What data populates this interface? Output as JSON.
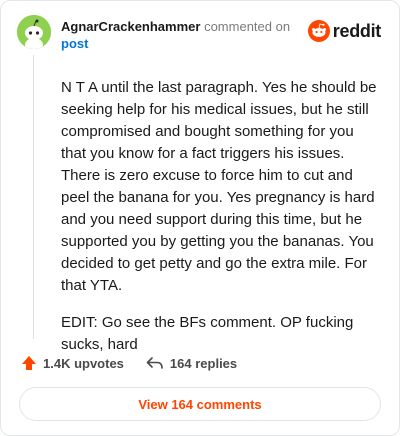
{
  "comment": {
    "author": "AgnarCrackenhammer",
    "action_text": "commented on",
    "post_link": "post",
    "paragraphs": [
      "N T A until the last paragraph. Yes he should be seeking help for his medical issues, but he still compromised and bought something for you that you know for a fact triggers his issues. There is zero excuse to force him to cut and peel the banana for you. Yes pregnancy is hard and you need support during this time, but he supported you by getting you the bananas. You decided to get petty and go the extra mile. For that YTA.",
      "EDIT: Go see the BFs comment. OP fucking sucks, hard"
    ],
    "upvotes": "1.4K upvotes",
    "replies": "164 replies",
    "view_comments_label": "View 164 comments"
  },
  "brand": {
    "logo_text": "reddit",
    "accent_color": "#ff4500",
    "link_color": "#0079d3",
    "avatar_color": "#8fd14f"
  },
  "icons": [
    "avatar-snoo-icon",
    "reddit-snoo-icon",
    "upvote-arrow-icon",
    "reply-arrow-icon"
  ]
}
